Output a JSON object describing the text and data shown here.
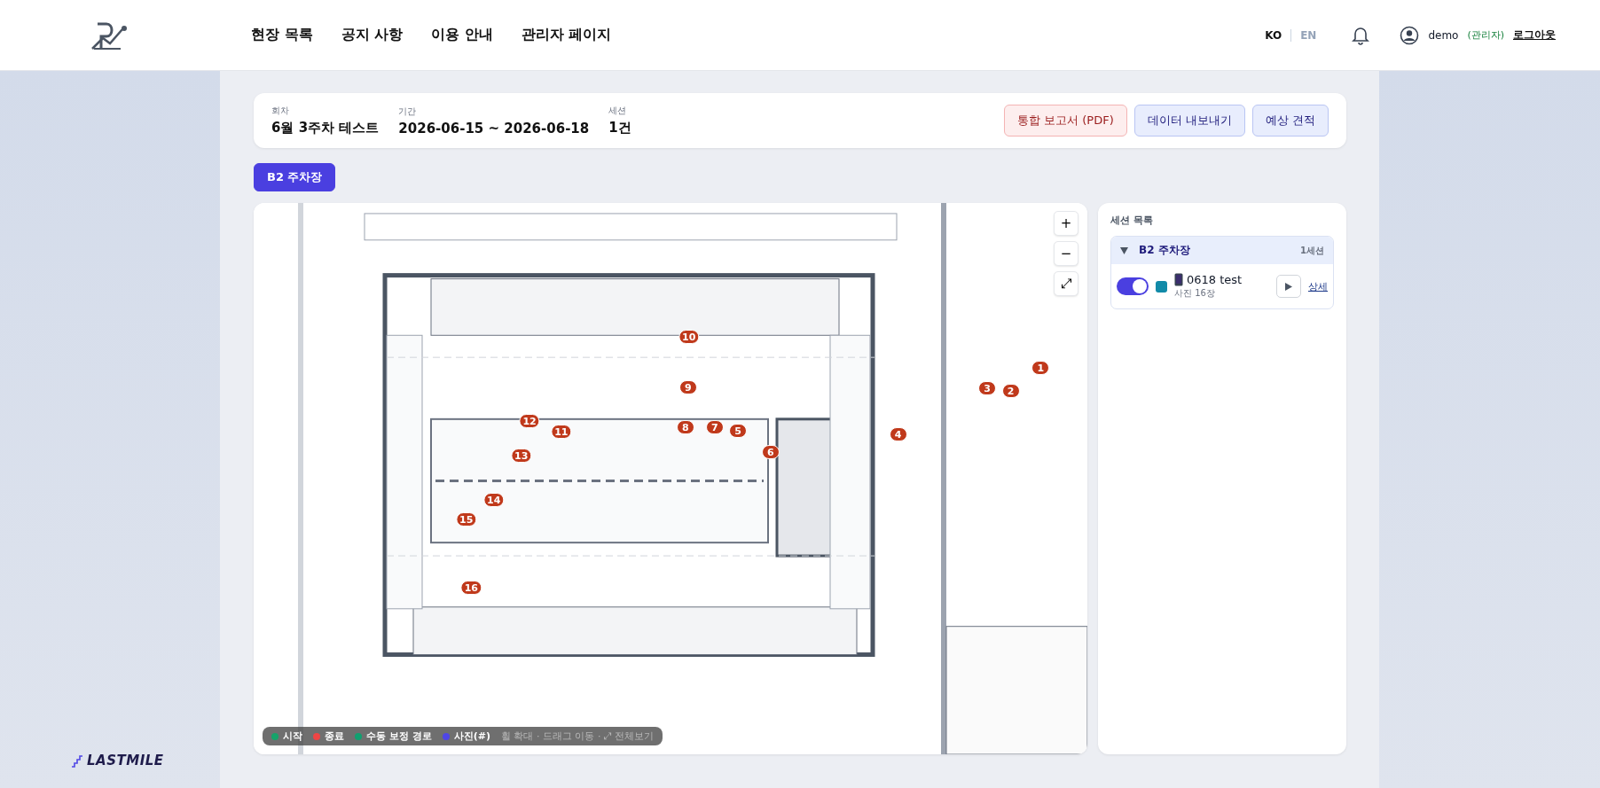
{
  "header": {
    "nav": [
      {
        "label": "현장 목록"
      },
      {
        "label": "공지 사항"
      },
      {
        "label": "이용 안내"
      },
      {
        "label": "관리자 페이지"
      }
    ],
    "languages": [
      {
        "label": "KO",
        "selected": true
      },
      {
        "label": "EN",
        "selected": false
      }
    ],
    "user": {
      "name": "demo",
      "role": "(관리자)",
      "logout": "로그아웃"
    }
  },
  "summary": {
    "fields": [
      {
        "label": "회차",
        "value": "6월 3주차 테스트"
      },
      {
        "label": "기간",
        "value": "2026-06-15 ~ 2026-06-18"
      },
      {
        "label": "세션",
        "value": "1건"
      }
    ],
    "buttons": [
      {
        "label": "통합 보고서 (PDF)",
        "kind": "danger"
      },
      {
        "label": "데이터 내보내기",
        "kind": "primary"
      },
      {
        "label": "예상 견적",
        "kind": "primary"
      }
    ]
  },
  "floor_tabs": [
    {
      "label": "B2 주차장",
      "selected": true
    }
  ],
  "map": {
    "zoom_controls": [
      "+",
      "−",
      "⤢"
    ],
    "markers": [
      {
        "label": "10"
      },
      {
        "label": "1"
      },
      {
        "label": "9"
      },
      {
        "label": "3"
      },
      {
        "label": "2"
      },
      {
        "label": "12"
      },
      {
        "label": "11"
      },
      {
        "label": "8"
      },
      {
        "label": "7"
      },
      {
        "label": "5"
      },
      {
        "label": "4"
      },
      {
        "label": "13"
      },
      {
        "label": "6"
      },
      {
        "label": "14"
      },
      {
        "label": "15"
      },
      {
        "label": "16"
      }
    ],
    "legend": [
      {
        "label": "시작",
        "color": "#16a36a"
      },
      {
        "label": "종료",
        "color": "#ef4444"
      },
      {
        "label": "수동 보정 경로",
        "color": "#10a070"
      },
      {
        "label": "사진(#)",
        "color": "#4f46e5"
      }
    ],
    "hint": "휠 확대 · 드래그 이동 · ⤢ 전체보기"
  },
  "sessions": {
    "title": "세션 목록",
    "groups": [
      {
        "name": "B2 주차장",
        "count": "1세션",
        "expanded": true,
        "items": [
          {
            "on": true,
            "color": "#118aa8",
            "name": "0618 test",
            "photos": "사진 16장",
            "detail": "상세"
          }
        ]
      }
    ]
  },
  "brand": {
    "name": "LASTMILE"
  }
}
